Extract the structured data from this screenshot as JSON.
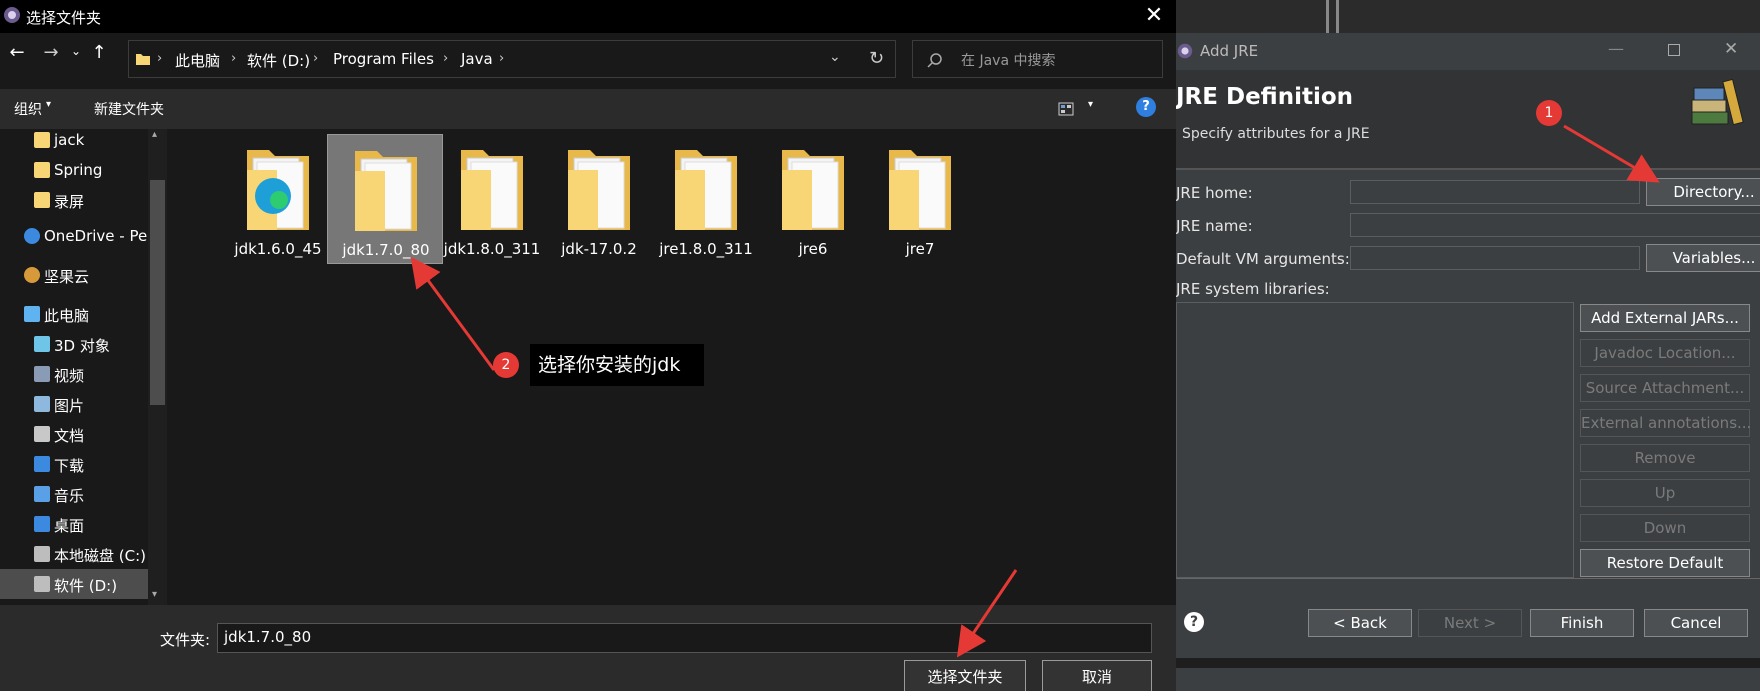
{
  "folder_dialog": {
    "title": "选择文件夹",
    "breadcrumb": [
      "此电脑",
      "软件 (D:)",
      "Program Files",
      "Java"
    ],
    "search_placeholder": "在 Java 中搜索",
    "commands": {
      "organize": "组织",
      "new_folder": "新建文件夹"
    },
    "sidebar": [
      {
        "label": "jack",
        "icon": "folder-icon"
      },
      {
        "label": "Spring",
        "icon": "folder-icon"
      },
      {
        "label": "录屏",
        "icon": "folder-icon"
      },
      {
        "label": "OneDrive - Personal",
        "icon": "onedrive-icon"
      },
      {
        "label": "坚果云",
        "icon": "nutstore-icon"
      },
      {
        "label": "此电脑",
        "icon": "this-pc-icon"
      },
      {
        "label": "3D 对象",
        "icon": "3d-objects-icon"
      },
      {
        "label": "视频",
        "icon": "video-icon"
      },
      {
        "label": "图片",
        "icon": "pictures-icon"
      },
      {
        "label": "文档",
        "icon": "documents-icon"
      },
      {
        "label": "下载",
        "icon": "download-icon"
      },
      {
        "label": "音乐",
        "icon": "music-icon"
      },
      {
        "label": "桌面",
        "icon": "desktop-icon"
      },
      {
        "label": "本地磁盘 (C:)",
        "icon": "drive-icon"
      },
      {
        "label": "软件 (D:)",
        "icon": "drive-icon"
      }
    ],
    "folders": [
      "jdk1.6.0_45",
      "jdk1.7.0_80",
      "jdk1.8.0_311",
      "jdk-17.0.2",
      "jre1.8.0_311",
      "jre6",
      "jre7"
    ],
    "selected_folder": "jdk1.7.0_80",
    "folder_label": "文件夹:",
    "folder_value": "jdk1.7.0_80",
    "select_button": "选择文件夹",
    "cancel_button": "取消"
  },
  "add_jre": {
    "window_title": "Add JRE",
    "heading": "JRE Definition",
    "subheading": "Specify attributes for a JRE",
    "labels": {
      "home": "JRE home:",
      "name": "JRE name:",
      "vm_args": "Default VM arguments:",
      "libraries": "JRE system libraries:"
    },
    "buttons": {
      "directory": "Directory...",
      "variables": "Variables...",
      "add_external": "Add External JARs...",
      "javadoc": "Javadoc Location...",
      "source": "Source Attachment...",
      "external_annotations": "External annotations...",
      "remove": "Remove",
      "up": "Up",
      "down": "Down",
      "restore": "Restore Default",
      "back": "< Back",
      "next": "Next >",
      "finish": "Finish",
      "cancel": "Cancel"
    }
  },
  "annotations": {
    "badge1": "1",
    "badge2": "2",
    "note2": "选择你安装的jdk"
  },
  "colors": {
    "accent_red": "#e53935",
    "folder_yellow": "#f8d675"
  }
}
